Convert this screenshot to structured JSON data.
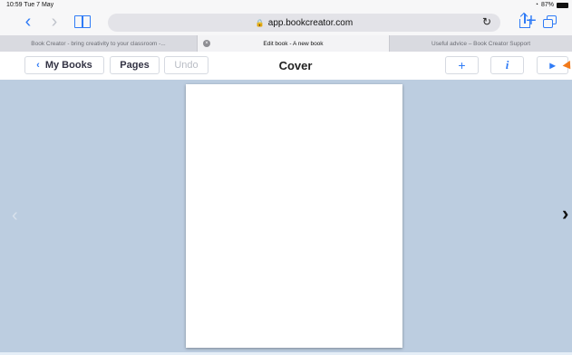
{
  "status_bar": {
    "time": "10:59",
    "date": "Tue 7 May",
    "wifi": "wifi-icon",
    "battery": "87%"
  },
  "browser": {
    "url": "app.bookcreator.com",
    "lock": "🔒",
    "back": "‹",
    "forward": "›",
    "reload": "↻",
    "new_tab": "+"
  },
  "tabs": [
    {
      "label": "Book Creator - bring creativity to your classroom -..."
    },
    {
      "label": "Edit book - A new book",
      "active": true,
      "close": "×"
    },
    {
      "label": "Useful advice – Book Creator Support"
    }
  ],
  "app_toolbar": {
    "my_books_chevron": "‹",
    "my_books_label": "My Books",
    "pages_label": "Pages",
    "undo_label": "Undo",
    "title": "Cover",
    "add_label": "+",
    "info_label": "i",
    "play_label": "▸"
  },
  "canvas": {
    "prev_arrow": "‹",
    "next_arrow": "›"
  },
  "colors": {
    "accent": "#2f7bf6",
    "background": "#bccde0",
    "cursor": "#f27a1a"
  }
}
